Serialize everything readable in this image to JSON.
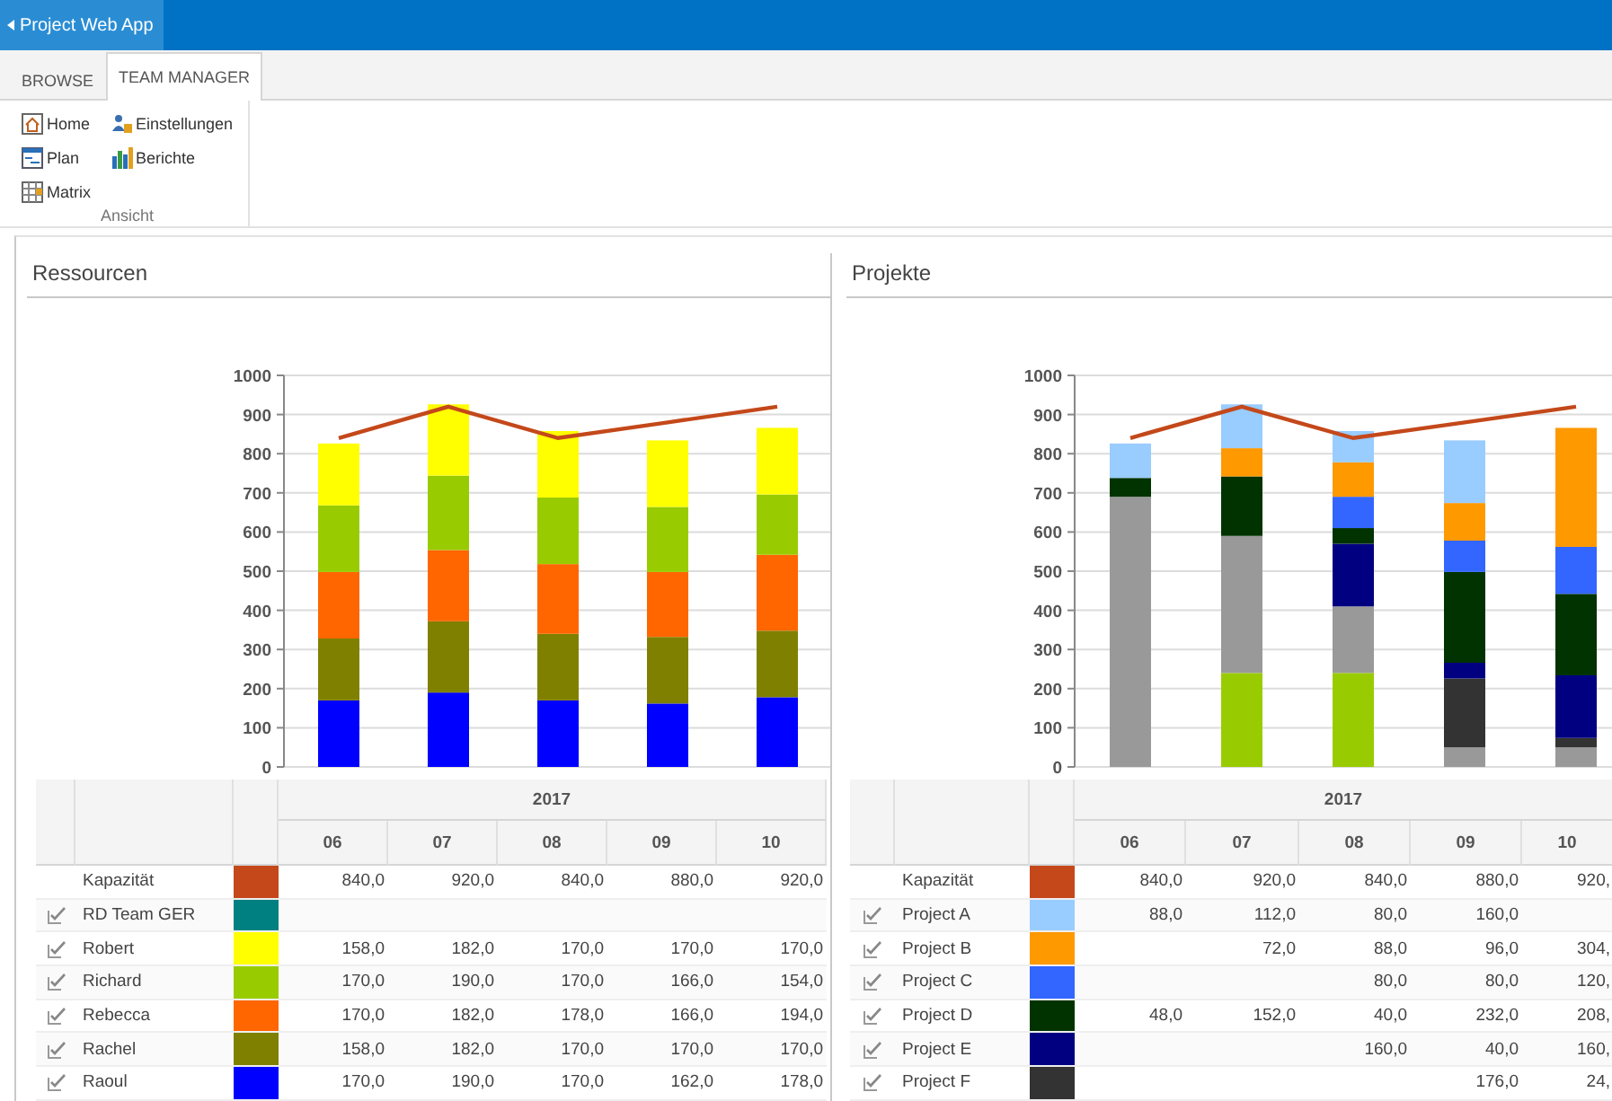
{
  "app_bar": {
    "title": "Project Web App"
  },
  "ribbon": {
    "tabs": [
      {
        "label": "BROWSE",
        "selected": false
      },
      {
        "label": "TEAM MANAGER",
        "selected": true
      }
    ],
    "group": {
      "label": "Ansicht",
      "buttons": [
        {
          "label": "Home",
          "kind": "home"
        },
        {
          "label": "Einstellungen",
          "kind": "settings"
        },
        {
          "label": "Plan",
          "kind": "plan"
        },
        {
          "label": "Berichte",
          "kind": "reports"
        },
        {
          "label": "Matrix",
          "kind": "matrix"
        }
      ]
    }
  },
  "panels": [
    {
      "title": "Ressourcen",
      "chart_data": {
        "type": "bar",
        "stacked": true,
        "grid": true,
        "ylim": [
          0,
          1000
        ],
        "yticks": [
          0,
          100,
          200,
          300,
          400,
          500,
          600,
          700,
          800,
          900,
          1000
        ],
        "series": [
          {
            "color": "#0000ff",
            "values": [
              170,
              190,
              170,
              162,
              178
            ]
          },
          {
            "color": "#808000",
            "values": [
              158,
              182,
              170,
              170,
              170
            ]
          },
          {
            "color": "#ff6600",
            "values": [
              170,
              182,
              178,
              166,
              194
            ]
          },
          {
            "color": "#99cc00",
            "values": [
              170,
              190,
              170,
              166,
              154
            ]
          },
          {
            "color": "#ffff00",
            "values": [
              158,
              182,
              170,
              170,
              170
            ]
          },
          {
            "color": "#c4481a",
            "type": "line",
            "values": [
              840,
              920,
              840,
              880,
              920
            ]
          }
        ]
      },
      "table": {
        "year": "2017",
        "months": [
          "06",
          "07",
          "08",
          "09",
          "10"
        ],
        "rows": [
          {
            "kind": "capacity",
            "name": "Kapazität",
            "color": "#c4481a",
            "values": {
              "0": "840,0",
              "1": "920,0",
              "2": "840,0",
              "3": "880,0",
              "4": "920,0"
            }
          },
          {
            "kind": "item",
            "checked": true,
            "name": "RD Team GER",
            "color": "#008080",
            "values": {}
          },
          {
            "kind": "item",
            "checked": true,
            "name": "Robert",
            "color": "#ffff00",
            "values": {
              "0": "158,0",
              "1": "182,0",
              "2": "170,0",
              "3": "170,0",
              "4": "170,0"
            }
          },
          {
            "kind": "item",
            "checked": true,
            "name": "Richard",
            "color": "#99cc00",
            "values": {
              "0": "170,0",
              "1": "190,0",
              "2": "170,0",
              "3": "166,0",
              "4": "154,0"
            }
          },
          {
            "kind": "item",
            "checked": true,
            "name": "Rebecca",
            "color": "#ff6600",
            "values": {
              "0": "170,0",
              "1": "182,0",
              "2": "178,0",
              "3": "166,0",
              "4": "194,0"
            }
          },
          {
            "kind": "item",
            "checked": true,
            "name": "Rachel",
            "color": "#808000",
            "values": {
              "0": "158,0",
              "1": "182,0",
              "2": "170,0",
              "3": "170,0",
              "4": "170,0"
            }
          },
          {
            "kind": "item",
            "checked": true,
            "name": "Raoul",
            "color": "#0000ff",
            "values": {
              "0": "170,0",
              "1": "190,0",
              "2": "170,0",
              "3": "162,0",
              "4": "178,0"
            }
          }
        ]
      }
    },
    {
      "title": "Projekte",
      "chart_data": {
        "type": "bar",
        "stacked": true,
        "grid": true,
        "ylim": [
          0,
          1000
        ],
        "yticks": [
          0,
          100,
          200,
          300,
          400,
          500,
          600,
          700,
          800,
          900,
          1000
        ],
        "series": [
          {
            "color": "#999999",
            "values": [
              0,
              0,
              0,
              50,
              50
            ]
          },
          {
            "color": "#99cc00",
            "values": [
              0,
              240,
              240,
              0,
              0
            ]
          },
          {
            "color": "#999999",
            "values": [
              690,
              350,
              170,
              0,
              0
            ]
          },
          {
            "color": "#333333",
            "values": [
              0,
              0,
              0,
              176,
              24
            ]
          },
          {
            "color": "#000080",
            "values": [
              0,
              0,
              160,
              40,
              160
            ]
          },
          {
            "color": "#003300",
            "values": [
              48,
              152,
              40,
              232,
              208
            ]
          },
          {
            "color": "#3366ff",
            "values": [
              0,
              0,
              80,
              80,
              120
            ]
          },
          {
            "color": "#ff9900",
            "values": [
              0,
              72,
              88,
              96,
              304
            ]
          },
          {
            "color": "#99ccff",
            "values": [
              88,
              112,
              80,
              160,
              0
            ]
          },
          {
            "color": "#c4481a",
            "type": "line",
            "values": [
              840,
              920,
              840,
              880,
              920
            ]
          }
        ]
      },
      "table": {
        "year": "2017",
        "months": [
          "06",
          "07",
          "08",
          "09",
          "10"
        ],
        "rows": [
          {
            "kind": "capacity",
            "name": "Kapazität",
            "color": "#c4481a",
            "values": {
              "0": "840,0",
              "1": "920,0",
              "2": "840,0",
              "3": "880,0",
              "4": "920,"
            }
          },
          {
            "kind": "item",
            "checked": true,
            "name": "Project A",
            "color": "#99ccff",
            "values": {
              "0": "88,0",
              "1": "112,0",
              "2": "80,0",
              "3": "160,0"
            }
          },
          {
            "kind": "item",
            "checked": true,
            "name": "Project B",
            "color": "#ff9900",
            "values": {
              "1": "72,0",
              "2": "88,0",
              "3": "96,0",
              "4": "304,"
            }
          },
          {
            "kind": "item",
            "checked": true,
            "name": "Project C",
            "color": "#3366ff",
            "values": {
              "2": "80,0",
              "3": "80,0",
              "4": "120,"
            }
          },
          {
            "kind": "item",
            "checked": true,
            "name": "Project D",
            "color": "#003300",
            "values": {
              "0": "48,0",
              "1": "152,0",
              "2": "40,0",
              "3": "232,0",
              "4": "208,"
            }
          },
          {
            "kind": "item",
            "checked": true,
            "name": "Project E",
            "color": "#000080",
            "values": {
              "2": "160,0",
              "3": "40,0",
              "4": "160,"
            }
          },
          {
            "kind": "item",
            "checked": true,
            "name": "Project F",
            "color": "#333333",
            "values": {
              "3": "176,0",
              "4": "24,"
            }
          }
        ]
      }
    }
  ]
}
